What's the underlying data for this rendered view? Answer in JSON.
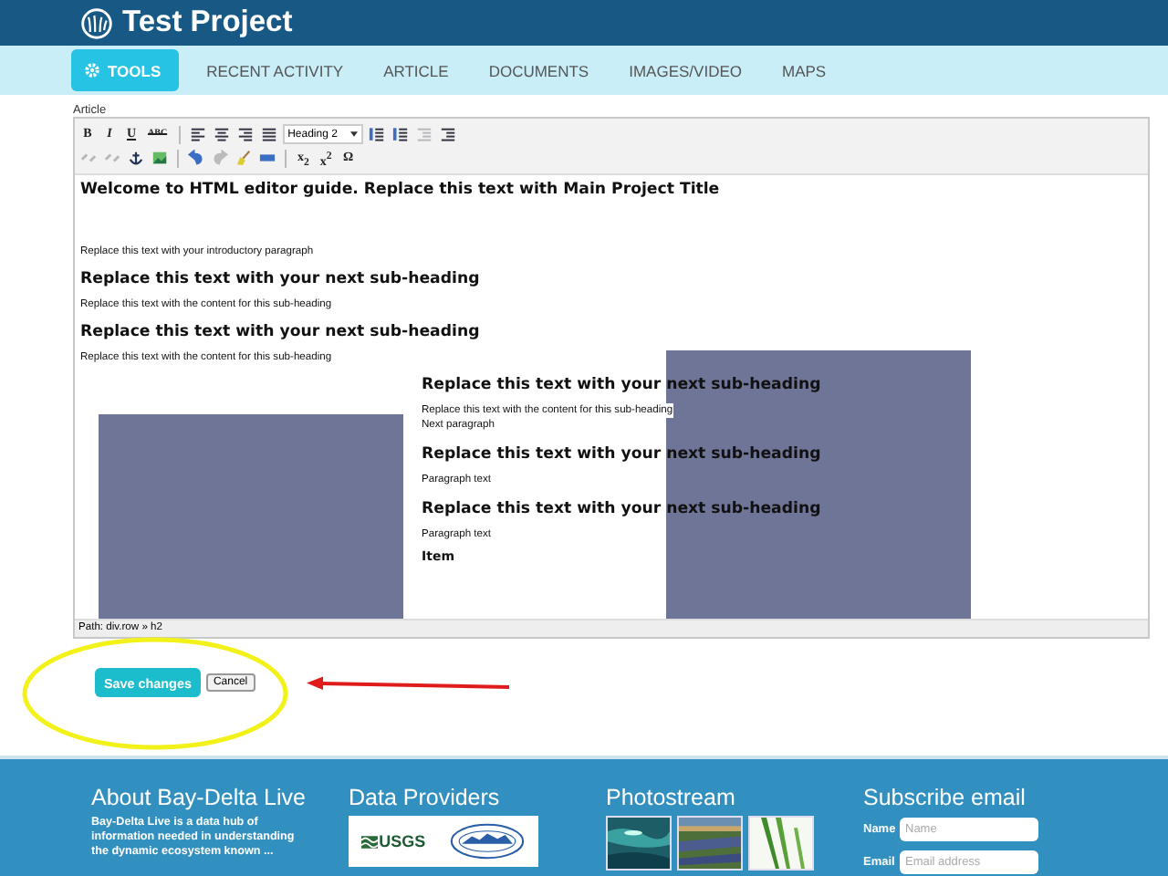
{
  "header": {
    "title": "Test Project"
  },
  "nav": [
    {
      "label": "TOOLS",
      "selected": true
    },
    {
      "label": "RECENT ACTIVITY",
      "selected": false
    },
    {
      "label": "ARTICLE",
      "selected": false
    },
    {
      "label": "DOCUMENTS",
      "selected": false
    },
    {
      "label": "IMAGES/VIDEO",
      "selected": false
    },
    {
      "label": "MAPS",
      "selected": false
    }
  ],
  "editor": {
    "label": "Article",
    "toolbar": [
      [
        {
          "kind": "text",
          "label": "B",
          "disabled": false
        },
        {
          "kind": "text",
          "label": "I",
          "disabled": false
        },
        {
          "kind": "text",
          "label": "U",
          "disabled": false
        },
        {
          "kind": "text",
          "label": "ABC",
          "disabled": false
        },
        {
          "kind": "sep"
        },
        {
          "kind": "icon",
          "disabled": false
        },
        {
          "kind": "icon",
          "disabled": false
        },
        {
          "kind": "icon",
          "disabled": false
        },
        {
          "kind": "icon",
          "disabled": false
        },
        {
          "kind": "select",
          "value": "Heading 2"
        },
        {
          "kind": "icon",
          "disabled": false
        },
        {
          "kind": "icon",
          "disabled": false
        },
        {
          "kind": "icon",
          "disabled": true
        },
        {
          "kind": "icon",
          "disabled": false
        }
      ],
      [
        {
          "kind": "icon",
          "disabled": true
        },
        {
          "kind": "icon",
          "disabled": true
        },
        {
          "kind": "icon",
          "disabled": false
        },
        {
          "kind": "icon",
          "disabled": false
        },
        {
          "kind": "sep"
        },
        {
          "kind": "icon",
          "disabled": false
        },
        {
          "kind": "icon",
          "disabled": true
        },
        {
          "kind": "icon",
          "disabled": false
        },
        {
          "kind": "icon",
          "disabled": false
        },
        {
          "kind": "sep"
        },
        {
          "kind": "text",
          "label": "x$_{2}$",
          "disabled": false
        },
        {
          "kind": "text",
          "label": "x$^{2}$",
          "disabled": false
        },
        {
          "kind": "text",
          "label": "Ω",
          "disabled": false
        }
      ]
    ],
    "content": [
      {
        "kind": "h1",
        "text": "Welcome to HTML editor guide. Replace this text with Main Project Title"
      },
      {
        "kind": "p",
        "text": "Replace this text with your introductory paragraph"
      },
      {
        "kind": "h2",
        "text": "Replace this text with your next sub-heading"
      },
      {
        "kind": "p",
        "text": "Replace this text with the content for this sub-heading"
      },
      {
        "kind": "h2",
        "text": "Replace this text with your next sub-heading"
      },
      {
        "kind": "p",
        "text": "Replace this text with the content for this sub-heading"
      }
    ],
    "row": [
      {
        "kind": "h2",
        "text": "Replace this text with your next sub-heading"
      },
      {
        "kind": "p",
        "text": "Replace this text with the content for this sub-heading"
      },
      {
        "kind": "p",
        "text": "Next paragraph"
      },
      {
        "kind": "h2",
        "text": "Replace this text with your next sub-heading"
      },
      {
        "kind": "p",
        "text": "Paragraph text"
      },
      {
        "kind": "h2",
        "text": "Replace this text with your next sub-heading"
      },
      {
        "kind": "p",
        "text": "Paragraph text"
      },
      {
        "kind": "h3",
        "text": "Item"
      }
    ],
    "path": "Path: div.row » h2"
  },
  "buttons": [
    {
      "kind": "primary",
      "label": "Save changes"
    },
    {
      "kind": "secondary",
      "label": "Cancel"
    }
  ],
  "footer": {
    "about": {
      "title": "About Bay-Delta Live",
      "text": "Bay-Delta Live is a data hub of information needed in understanding the dynamic ecosystem known ..."
    },
    "providers": {
      "title": "Data Providers",
      "logo_text": "USGS"
    },
    "photostream": {
      "title": "Photostream"
    },
    "subscribe": {
      "title": "Subscribe email",
      "fields": [
        {
          "label": "Name",
          "placeholder": "Name"
        },
        {
          "label": "Email",
          "placeholder": "Email address"
        }
      ]
    }
  }
}
